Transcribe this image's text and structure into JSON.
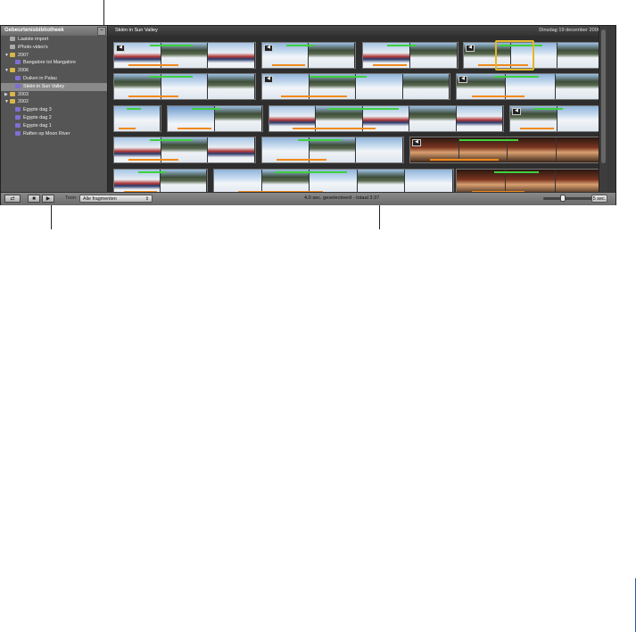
{
  "sidebar": {
    "title": "Gebeurtenisbibliotheek",
    "items": [
      {
        "label": "Laatste import",
        "icon": "import-icon",
        "level": 1
      },
      {
        "label": "iPhoto-video's",
        "icon": "iphoto-icon",
        "level": 1
      },
      {
        "label": "2007",
        "icon": "folder-icon",
        "level": 0,
        "expanded": true
      },
      {
        "label": "Bangalore tot Mangalore",
        "icon": "event-icon",
        "level": 2
      },
      {
        "label": "2006",
        "icon": "folder-icon",
        "level": 0,
        "expanded": true
      },
      {
        "label": "Duiken in Palau",
        "icon": "event-icon",
        "level": 2
      },
      {
        "label": "Skiën in Sun Valley",
        "icon": "event-icon",
        "level": 2,
        "selected": true
      },
      {
        "label": "2003",
        "icon": "folder-icon",
        "level": 0,
        "expanded": false
      },
      {
        "label": "2002",
        "icon": "folder-icon",
        "level": 0,
        "expanded": true
      },
      {
        "label": "Egypte dag 3",
        "icon": "event-icon",
        "level": 2
      },
      {
        "label": "Egypte dag 2",
        "icon": "event-icon",
        "level": 2
      },
      {
        "label": "Egypte dag 1",
        "icon": "event-icon",
        "level": 2
      },
      {
        "label": "Raften op Moon River",
        "icon": "event-icon",
        "level": 2
      }
    ]
  },
  "browser": {
    "event_title": "Skiën in Sun Valley",
    "event_date": "Dinsdag 19 december 2006"
  },
  "toolbar": {
    "show_label": "Toon:",
    "show_value": "Alle fragmenten",
    "status": "4,0 sec. geselecteerd - totaal 3:37",
    "zoom_label": "5 sec."
  },
  "colors": {
    "selection_highlight": "#e4b52a",
    "favorite_bar": "#3fd13f",
    "used_bar": "#f08a1c",
    "folder": "#d8b64a",
    "event": "#7f6fd3"
  }
}
